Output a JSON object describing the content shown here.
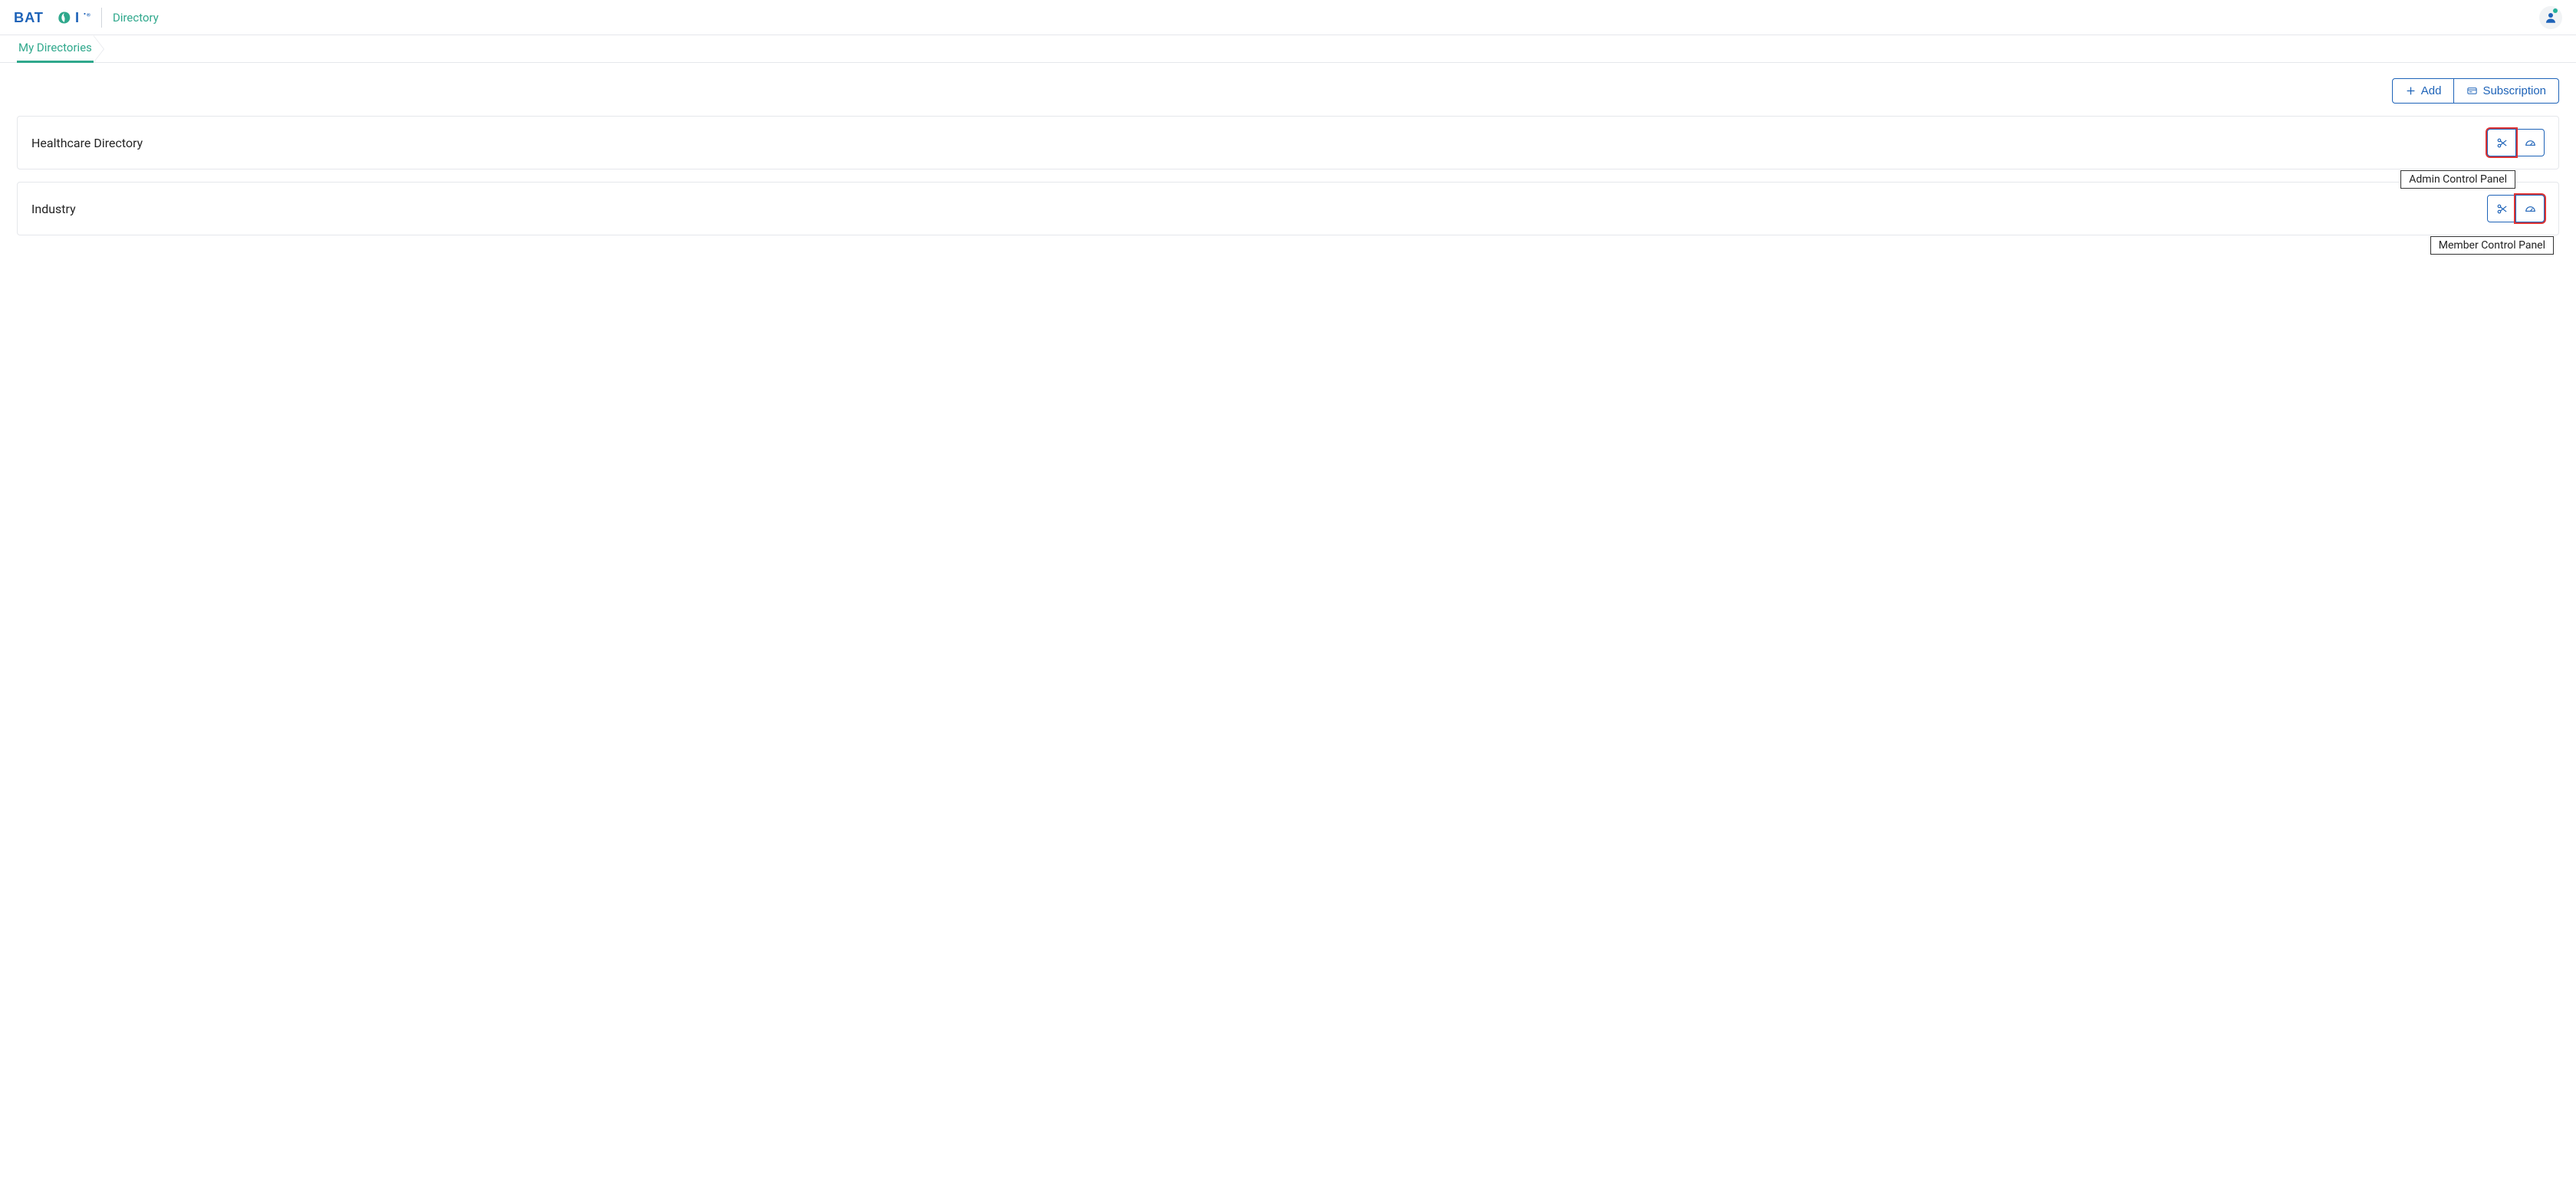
{
  "header": {
    "brand": "BAT I",
    "title": "Directory"
  },
  "breadcrumb": {
    "current": "My Directories"
  },
  "actions": {
    "add": "Add",
    "subscription": "Subscription"
  },
  "directories": [
    {
      "name": "Healthcare Directory",
      "tooltip": "Admin Control Panel",
      "highlight": "admin"
    },
    {
      "name": "Industry",
      "tooltip": "Member Control Panel",
      "highlight": "member"
    }
  ]
}
